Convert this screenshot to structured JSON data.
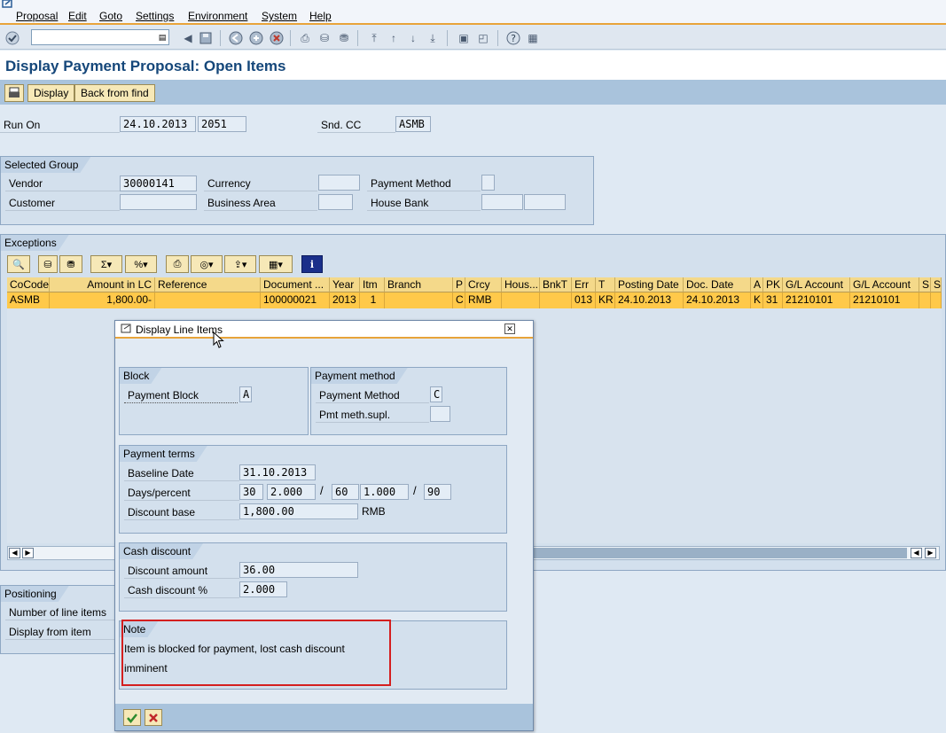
{
  "menu": [
    "Proposal",
    "Edit",
    "Goto",
    "Settings",
    "Environment",
    "System",
    "Help"
  ],
  "page_title": "Display Payment Proposal: Open Items",
  "app_toolbar": {
    "display_label": "Display",
    "back_label": "Back from find"
  },
  "header": {
    "run_on_label": "Run On",
    "run_on_date": "24.10.2013",
    "run_on_id": "2051",
    "snd_cc_label": "Snd. CC",
    "snd_cc_value": "ASMB"
  },
  "selected_group": {
    "title": "Selected Group",
    "vendor_label": "Vendor",
    "vendor_value": "30000141",
    "customer_label": "Customer",
    "currency_label": "Currency",
    "business_area_label": "Business Area",
    "payment_method_label": "Payment Method",
    "house_bank_label": "House Bank"
  },
  "exceptions": {
    "title": "Exceptions",
    "columns": [
      "CoCode",
      "Amount in LC",
      "Reference",
      "Document ...",
      "Year",
      "Itm",
      "Branch",
      "P",
      "Crcy",
      "Hous...",
      "BnkT",
      "Err",
      "T",
      "Posting Date",
      "Doc. Date",
      "A",
      "PK",
      "G/L Account",
      "G/L Account",
      "S",
      "S"
    ],
    "row": [
      "ASMB",
      "1,800.00-",
      "",
      "100000021",
      "2013",
      "1",
      "",
      "C",
      "RMB",
      "",
      "",
      "013",
      "KR",
      "24.10.2013",
      "24.10.2013",
      "K",
      "31",
      "21210101",
      "21210101",
      "",
      ""
    ]
  },
  "positioning": {
    "title": "Positioning",
    "line_items_label": "Number of line items",
    "display_from_label": "Display from item"
  },
  "dialog": {
    "title": "Display Line Items",
    "block": {
      "title": "Block",
      "payment_block_label": "Payment Block",
      "payment_block_value": "A"
    },
    "payment_method": {
      "title": "Payment method",
      "method_label": "Payment Method",
      "method_value": "C",
      "suppl_label": "Pmt meth.supl."
    },
    "payment_terms": {
      "title": "Payment terms",
      "baseline_label": "Baseline Date",
      "baseline_value": "31.10.2013",
      "days_label": "Days/percent",
      "d1": "30",
      "p1": "2.000",
      "d2": "60",
      "p2": "1.000",
      "d3": "90",
      "slash": "/",
      "discount_base_label": "Discount base",
      "discount_base_value": "1,800.00",
      "currency": "RMB"
    },
    "cash_discount": {
      "title": "Cash discount",
      "amount_label": "Discount amount",
      "amount_value": "36.00",
      "percent_label": "Cash discount %",
      "percent_value": "2.000"
    },
    "note": {
      "title": "Note",
      "line1": "Item is blocked for payment, lost cash discount",
      "line2": "imminent"
    }
  },
  "colors": {
    "accent": "#e8a43a",
    "title_blue": "#15477a",
    "row_highlight": "#ffc94a",
    "note_border": "#d41f1f"
  }
}
